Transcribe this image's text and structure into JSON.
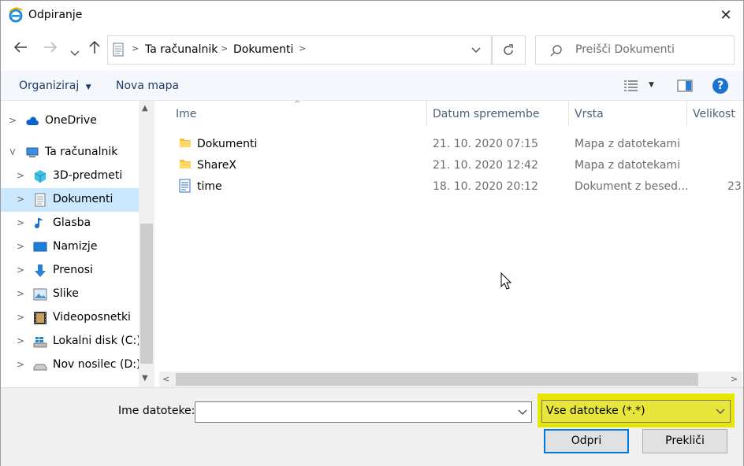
{
  "window": {
    "title": "Odpiranje",
    "close_glyph": "✕"
  },
  "address_bar": {
    "crumbs": [
      "Ta računalnik",
      "Dokumenti"
    ],
    "search_placeholder": "Preišči Dokumenti"
  },
  "toolbar": {
    "organize_label": "Organiziraj",
    "new_folder_label": "Nova mapa",
    "help_label": "?"
  },
  "sidebar": {
    "items": [
      {
        "label": "OneDrive",
        "icon": "cloud-icon"
      },
      {
        "label": "Ta računalnik",
        "icon": "computer-icon"
      },
      {
        "label": "3D-predmeti",
        "icon": "cube-icon"
      },
      {
        "label": "Dokumenti",
        "icon": "document-icon"
      },
      {
        "label": "Glasba",
        "icon": "music-icon"
      },
      {
        "label": "Namizje",
        "icon": "desktop-icon"
      },
      {
        "label": "Prenosi",
        "icon": "download-icon"
      },
      {
        "label": "Slike",
        "icon": "pictures-icon"
      },
      {
        "label": "Videoposnetki",
        "icon": "video-icon"
      },
      {
        "label": "Lokalni disk (C:)",
        "icon": "windows-drive-icon"
      },
      {
        "label": "Nov nosilec (D:)",
        "icon": "drive-icon"
      }
    ]
  },
  "file_list": {
    "columns": [
      "Ime",
      "Datum spremembe",
      "Vrsta",
      "Velikost"
    ],
    "rows": [
      {
        "name": "Dokumenti",
        "date": "21. 10. 2020 07:15",
        "type": "Mapa z datotekami",
        "size": "",
        "icon": "folder-icon"
      },
      {
        "name": "ShareX",
        "date": "21. 10. 2020 12:42",
        "type": "Mapa z datotekami",
        "size": "",
        "icon": "folder-icon"
      },
      {
        "name": "time",
        "date": "18. 10. 2020 20:12",
        "type": "Dokument z besed...",
        "size": "23",
        "icon": "text-document-icon"
      }
    ]
  },
  "footer": {
    "filename_label": "Ime datoteke:",
    "filename_value": "",
    "filetype_value": "Vse datoteke (*.*)",
    "open_label": "Odpri",
    "cancel_label": "Prekliči"
  },
  "colors": {
    "selection": "#cce8ff",
    "highlight": "#e6e600",
    "accent": "#0078d7"
  }
}
